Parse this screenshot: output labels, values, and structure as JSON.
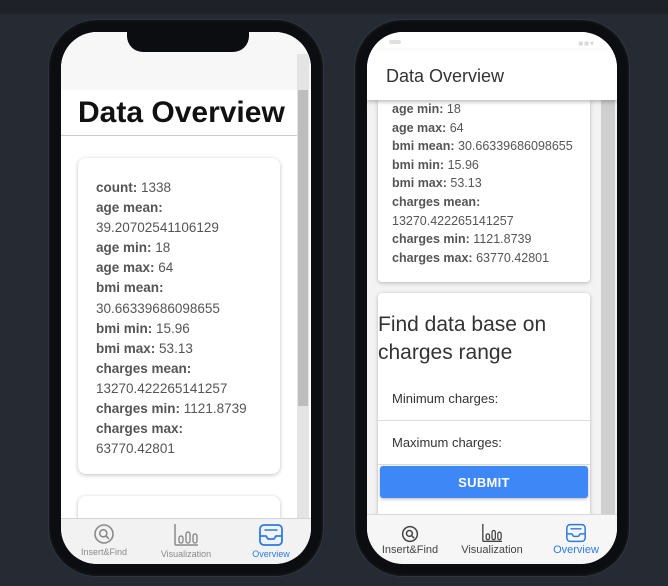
{
  "left_phone": {
    "page_title": "Data Overview",
    "stats": [
      {
        "label": "count:",
        "value": "1338"
      },
      {
        "label": "age mean:",
        "value": "39.20702541106129"
      },
      {
        "label": "age min:",
        "value": "18"
      },
      {
        "label": "age max:",
        "value": "64"
      },
      {
        "label": "bmi mean:",
        "value": "30.66339686098655"
      },
      {
        "label": "bmi min:",
        "value": "15.96"
      },
      {
        "label": "bmi max:",
        "value": "53.13"
      },
      {
        "label": "charges mean:",
        "value": "13270.422265141257"
      },
      {
        "label": "charges min:",
        "value": "1121.8739"
      },
      {
        "label": "charges max:",
        "value": "63770.42801"
      }
    ],
    "nav": [
      {
        "label": "Insert&Find",
        "icon": "search-icon",
        "active": false
      },
      {
        "label": "Visualization",
        "icon": "bar-chart-icon",
        "active": false
      },
      {
        "label": "Overview",
        "icon": "inbox-icon",
        "active": true
      }
    ]
  },
  "right_phone": {
    "header_title": "Data Overview",
    "stats": [
      {
        "label": "age min:",
        "value": "18"
      },
      {
        "label": "age max:",
        "value": "64"
      },
      {
        "label": "bmi mean:",
        "value": "30.66339686098655"
      },
      {
        "label": "bmi min:",
        "value": "15.96"
      },
      {
        "label": "bmi max:",
        "value": "53.13"
      },
      {
        "label": "charges mean:",
        "value": "13270.422265141257"
      },
      {
        "label": "charges min:",
        "value": "1121.8739"
      },
      {
        "label": "charges max:",
        "value": "63770.42801"
      }
    ],
    "find_title": "Find data base on charges range",
    "min_label": "Minimum charges:",
    "max_label": "Maximum charges:",
    "submit_label": "SUBMIT",
    "nav": [
      {
        "label": "Insert&Find",
        "icon": "search-icon",
        "active": false
      },
      {
        "label": "Visualization",
        "icon": "bar-chart-icon",
        "active": false
      },
      {
        "label": "Overview",
        "icon": "inbox-icon",
        "active": true
      }
    ]
  },
  "colors": {
    "accent": "#2a7be4",
    "submit_button": "#3e87f7",
    "background": "#262b33"
  }
}
